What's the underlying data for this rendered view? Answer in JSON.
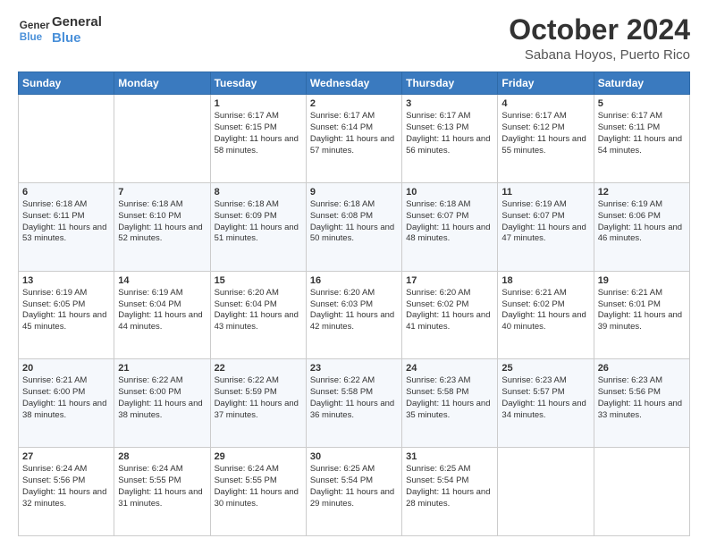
{
  "header": {
    "logo_line1": "General",
    "logo_line2": "Blue",
    "month": "October 2024",
    "location": "Sabana Hoyos, Puerto Rico"
  },
  "days_of_week": [
    "Sunday",
    "Monday",
    "Tuesday",
    "Wednesday",
    "Thursday",
    "Friday",
    "Saturday"
  ],
  "weeks": [
    [
      {
        "day": "",
        "info": ""
      },
      {
        "day": "",
        "info": ""
      },
      {
        "day": "1",
        "info": "Sunrise: 6:17 AM\nSunset: 6:15 PM\nDaylight: 11 hours and 58 minutes."
      },
      {
        "day": "2",
        "info": "Sunrise: 6:17 AM\nSunset: 6:14 PM\nDaylight: 11 hours and 57 minutes."
      },
      {
        "day": "3",
        "info": "Sunrise: 6:17 AM\nSunset: 6:13 PM\nDaylight: 11 hours and 56 minutes."
      },
      {
        "day": "4",
        "info": "Sunrise: 6:17 AM\nSunset: 6:12 PM\nDaylight: 11 hours and 55 minutes."
      },
      {
        "day": "5",
        "info": "Sunrise: 6:17 AM\nSunset: 6:11 PM\nDaylight: 11 hours and 54 minutes."
      }
    ],
    [
      {
        "day": "6",
        "info": "Sunrise: 6:18 AM\nSunset: 6:11 PM\nDaylight: 11 hours and 53 minutes."
      },
      {
        "day": "7",
        "info": "Sunrise: 6:18 AM\nSunset: 6:10 PM\nDaylight: 11 hours and 52 minutes."
      },
      {
        "day": "8",
        "info": "Sunrise: 6:18 AM\nSunset: 6:09 PM\nDaylight: 11 hours and 51 minutes."
      },
      {
        "day": "9",
        "info": "Sunrise: 6:18 AM\nSunset: 6:08 PM\nDaylight: 11 hours and 50 minutes."
      },
      {
        "day": "10",
        "info": "Sunrise: 6:18 AM\nSunset: 6:07 PM\nDaylight: 11 hours and 48 minutes."
      },
      {
        "day": "11",
        "info": "Sunrise: 6:19 AM\nSunset: 6:07 PM\nDaylight: 11 hours and 47 minutes."
      },
      {
        "day": "12",
        "info": "Sunrise: 6:19 AM\nSunset: 6:06 PM\nDaylight: 11 hours and 46 minutes."
      }
    ],
    [
      {
        "day": "13",
        "info": "Sunrise: 6:19 AM\nSunset: 6:05 PM\nDaylight: 11 hours and 45 minutes."
      },
      {
        "day": "14",
        "info": "Sunrise: 6:19 AM\nSunset: 6:04 PM\nDaylight: 11 hours and 44 minutes."
      },
      {
        "day": "15",
        "info": "Sunrise: 6:20 AM\nSunset: 6:04 PM\nDaylight: 11 hours and 43 minutes."
      },
      {
        "day": "16",
        "info": "Sunrise: 6:20 AM\nSunset: 6:03 PM\nDaylight: 11 hours and 42 minutes."
      },
      {
        "day": "17",
        "info": "Sunrise: 6:20 AM\nSunset: 6:02 PM\nDaylight: 11 hours and 41 minutes."
      },
      {
        "day": "18",
        "info": "Sunrise: 6:21 AM\nSunset: 6:02 PM\nDaylight: 11 hours and 40 minutes."
      },
      {
        "day": "19",
        "info": "Sunrise: 6:21 AM\nSunset: 6:01 PM\nDaylight: 11 hours and 39 minutes."
      }
    ],
    [
      {
        "day": "20",
        "info": "Sunrise: 6:21 AM\nSunset: 6:00 PM\nDaylight: 11 hours and 38 minutes."
      },
      {
        "day": "21",
        "info": "Sunrise: 6:22 AM\nSunset: 6:00 PM\nDaylight: 11 hours and 38 minutes."
      },
      {
        "day": "22",
        "info": "Sunrise: 6:22 AM\nSunset: 5:59 PM\nDaylight: 11 hours and 37 minutes."
      },
      {
        "day": "23",
        "info": "Sunrise: 6:22 AM\nSunset: 5:58 PM\nDaylight: 11 hours and 36 minutes."
      },
      {
        "day": "24",
        "info": "Sunrise: 6:23 AM\nSunset: 5:58 PM\nDaylight: 11 hours and 35 minutes."
      },
      {
        "day": "25",
        "info": "Sunrise: 6:23 AM\nSunset: 5:57 PM\nDaylight: 11 hours and 34 minutes."
      },
      {
        "day": "26",
        "info": "Sunrise: 6:23 AM\nSunset: 5:56 PM\nDaylight: 11 hours and 33 minutes."
      }
    ],
    [
      {
        "day": "27",
        "info": "Sunrise: 6:24 AM\nSunset: 5:56 PM\nDaylight: 11 hours and 32 minutes."
      },
      {
        "day": "28",
        "info": "Sunrise: 6:24 AM\nSunset: 5:55 PM\nDaylight: 11 hours and 31 minutes."
      },
      {
        "day": "29",
        "info": "Sunrise: 6:24 AM\nSunset: 5:55 PM\nDaylight: 11 hours and 30 minutes."
      },
      {
        "day": "30",
        "info": "Sunrise: 6:25 AM\nSunset: 5:54 PM\nDaylight: 11 hours and 29 minutes."
      },
      {
        "day": "31",
        "info": "Sunrise: 6:25 AM\nSunset: 5:54 PM\nDaylight: 11 hours and 28 minutes."
      },
      {
        "day": "",
        "info": ""
      },
      {
        "day": "",
        "info": ""
      }
    ]
  ]
}
